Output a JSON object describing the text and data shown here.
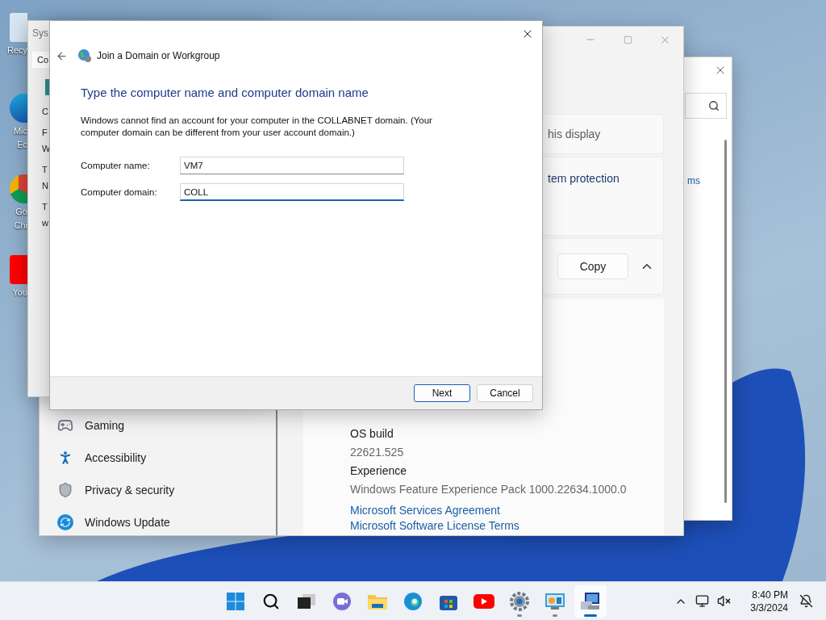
{
  "desktop_icons": [
    {
      "kind": "recycle",
      "label": [
        "Recy"
      ]
    },
    {
      "kind": "edge",
      "label": [
        "Mic",
        "Ec"
      ]
    },
    {
      "kind": "chrome",
      "label": [
        "Go",
        "Chi"
      ]
    },
    {
      "kind": "youtube",
      "label": [
        "You"
      ]
    }
  ],
  "control_window": {
    "search_link": "ms"
  },
  "settings_window": {
    "cards": [
      {
        "kind": "text",
        "text": "his display"
      },
      {
        "kind": "link",
        "text": "tem protection"
      },
      {
        "kind": "copy",
        "text": "Copy"
      }
    ],
    "nav": [
      {
        "kind": "gaming",
        "label": "Gaming"
      },
      {
        "kind": "accessibility",
        "label": "Accessibility"
      },
      {
        "kind": "privacy",
        "label": "Privacy & security"
      },
      {
        "kind": "update",
        "label": "Windows Update"
      }
    ],
    "specs": [
      {
        "label": "OS build",
        "value": "22621.525"
      },
      {
        "label": "Experience",
        "value": "Windows Feature Experience Pack 1000.22634.1000.0"
      }
    ],
    "links": [
      "Microsoft Services Agreement",
      "Microsoft Software License Terms"
    ]
  },
  "system_properties": {
    "title": "Sys",
    "tab": "Co",
    "fragments": [
      [
        "C"
      ],
      [
        "F",
        "W"
      ],
      [
        "T",
        "N"
      ],
      [
        "T",
        "w"
      ]
    ]
  },
  "dialog": {
    "title": "Join a Domain or Workgroup",
    "heading": "Type the computer name and computer domain name",
    "message": "Windows cannot find an account for your computer in the COLLABNET domain. (Your computer domain can be different from your user account domain.)",
    "fields": [
      {
        "label": "Computer name:",
        "value": "VM7",
        "focused": false
      },
      {
        "label": "Computer domain:",
        "value": "COLL",
        "focused": true
      }
    ],
    "buttons": [
      {
        "label": "Next",
        "default": true
      },
      {
        "label": "Cancel",
        "default": false
      }
    ]
  },
  "taskbar": {
    "apps": [
      {
        "kind": "start",
        "running": false,
        "selected": false
      },
      {
        "kind": "search",
        "running": false,
        "selected": false
      },
      {
        "kind": "taskview",
        "running": false,
        "selected": false
      },
      {
        "kind": "chat",
        "running": false,
        "selected": false
      },
      {
        "kind": "folder",
        "running": false,
        "selected": false
      },
      {
        "kind": "edge",
        "running": false,
        "selected": false
      },
      {
        "kind": "store",
        "running": false,
        "selected": false
      },
      {
        "kind": "youtube",
        "running": false,
        "selected": false
      },
      {
        "kind": "settings",
        "running": true,
        "selected": false
      },
      {
        "kind": "controlpanel",
        "running": true,
        "selected": false
      },
      {
        "kind": "computer",
        "running": true,
        "selected": true
      }
    ],
    "time": "8:40 PM",
    "date": "3/3/2024"
  }
}
